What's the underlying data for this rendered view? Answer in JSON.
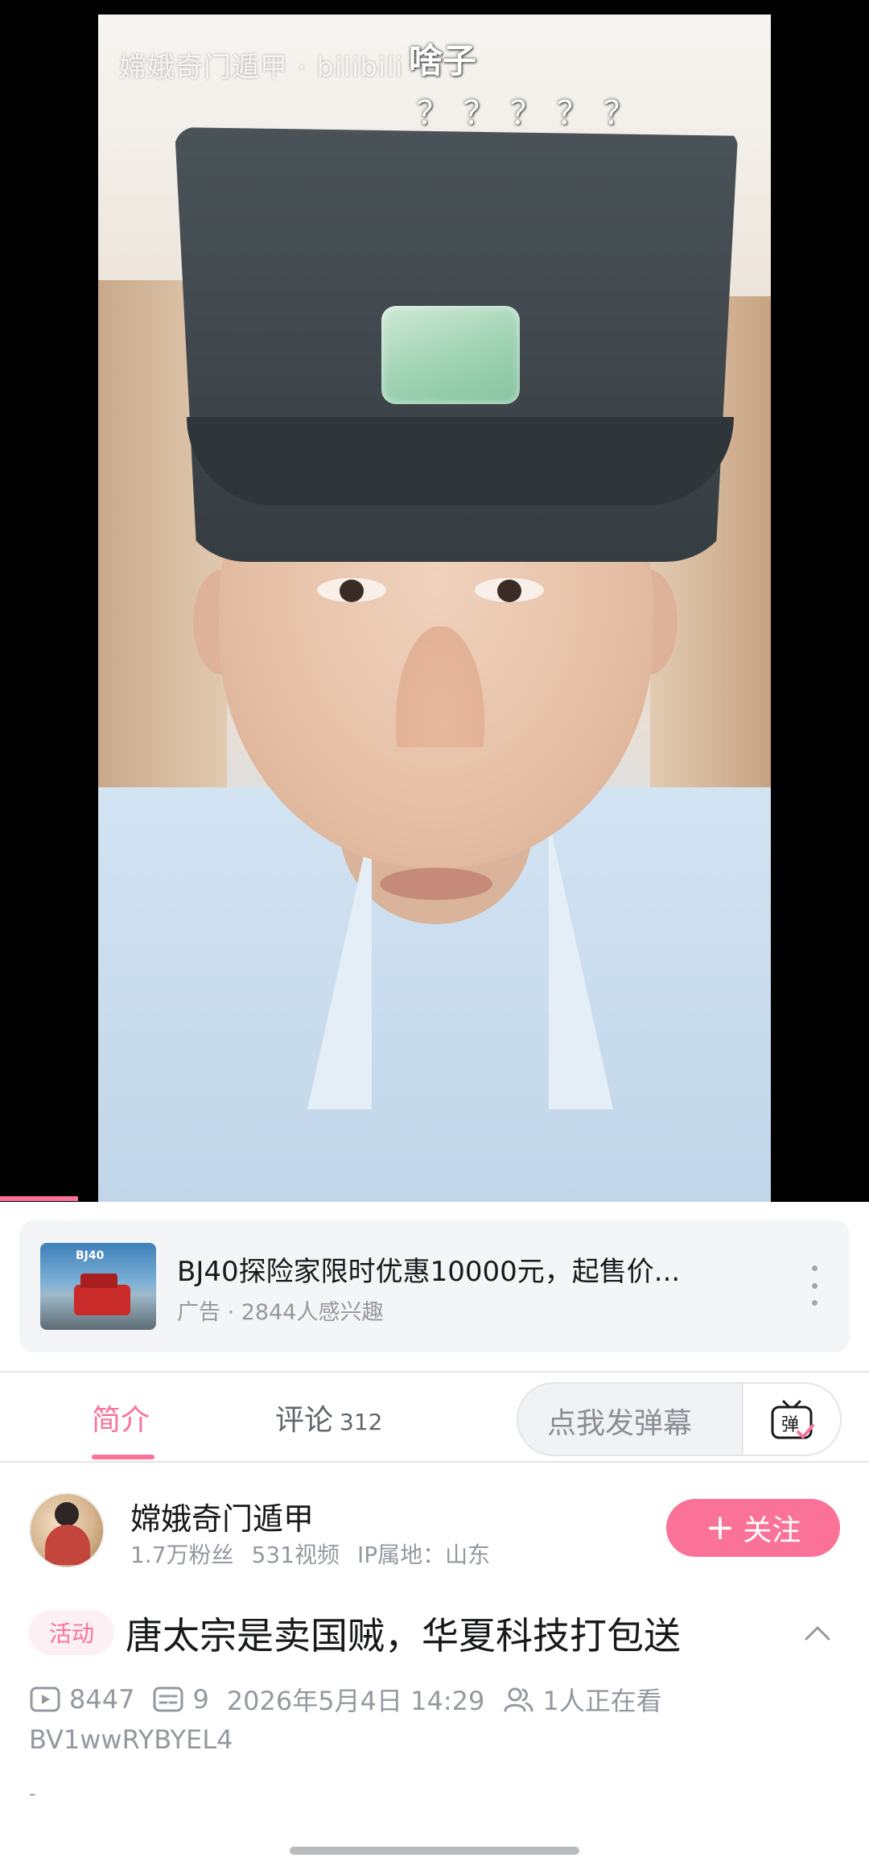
{
  "video": {
    "watermark": "嫦娥奇门遁甲 · bilibili",
    "overlay_caption": "啥子",
    "overlay_questions": "？？？？？",
    "progress": 0.09
  },
  "ad": {
    "thumb_tag": "BJ40",
    "title": "BJ40探险家限时优惠10000元，起售价...",
    "meta": "广告 · 2844人感兴趣",
    "more_icon": "more-vertical-icon"
  },
  "tabs": {
    "intro": "简介",
    "comments_label": "评论",
    "comments_count": "312",
    "danmaku_placeholder": "点我发弹幕",
    "danmaku_icon": "danmaku-tv-icon",
    "danmaku_icon_text": "弹"
  },
  "uploader": {
    "name": "嫦娥奇门遁甲",
    "fans": "1.7万粉丝",
    "videos": "531视频",
    "ip": "IP属地：山东",
    "follow_plus": "+",
    "follow_label": "关注"
  },
  "detail": {
    "tag": "活动",
    "title": "唐太宗是卖国贼，华夏科技打包送",
    "plays": "8447",
    "danmaku_count": "9",
    "datetime": "2026年5月4日 14:29",
    "watching": "1人正在看",
    "bvid": "BV1wwRYBYEL4",
    "desc": "-"
  },
  "colors": {
    "accent": "#fb7299",
    "text_primary": "#18191c",
    "text_secondary": "#9499a0"
  }
}
